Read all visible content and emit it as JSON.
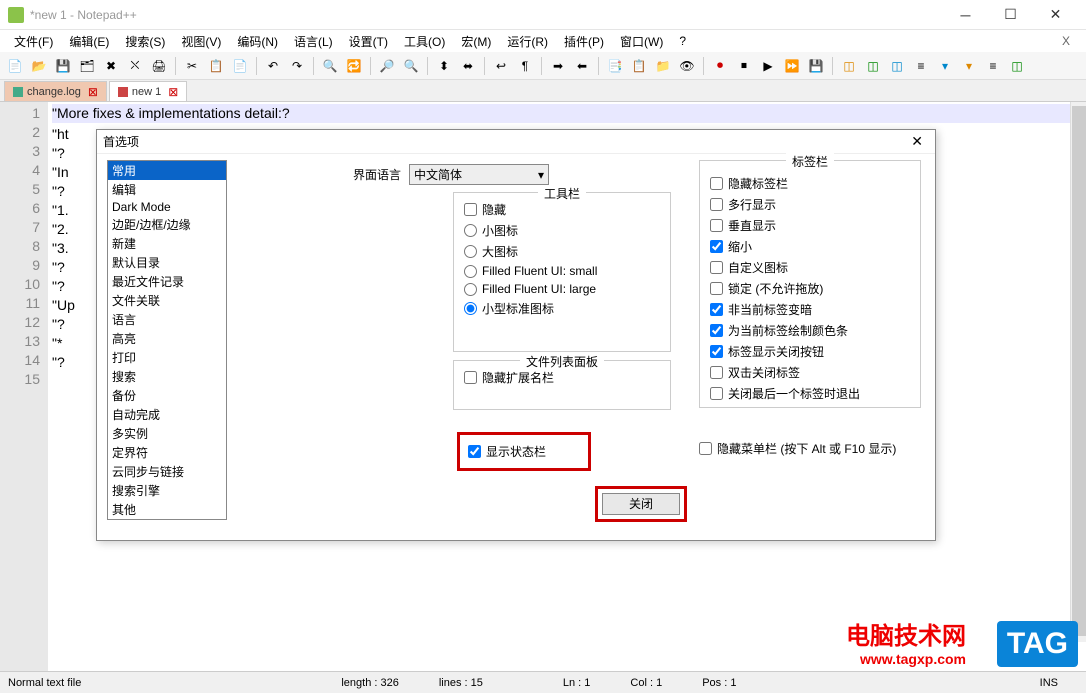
{
  "window": {
    "title": "*new 1 - Notepad++"
  },
  "menu": {
    "items": [
      "文件(F)",
      "编辑(E)",
      "搜索(S)",
      "视图(V)",
      "编码(N)",
      "语言(L)",
      "设置(T)",
      "工具(O)",
      "宏(M)",
      "运行(R)",
      "插件(P)",
      "窗口(W)",
      "?"
    ],
    "x": "X"
  },
  "tabs": [
    {
      "label": "change.log",
      "active": false
    },
    {
      "label": "new 1",
      "active": true
    }
  ],
  "code": {
    "lines": [
      "\"More fixes & implementations detail:?",
      "\"ht",
      "\"?",
      "\"In",
      "\"?",
      "\"1.",
      "\"2.",
      "\"3.",
      "\"?",
      "\"?",
      "\"Up",
      "\"?",
      "\"*",
      "\"?"
    ],
    "line_numbers": [
      "1",
      "2",
      "3",
      "4",
      "5",
      "6",
      "7",
      "8",
      "9",
      "10",
      "11",
      "12",
      "13",
      "14",
      "15"
    ]
  },
  "statusbar": {
    "file_type": "Normal text file",
    "length": "length : 326",
    "lines": "lines : 15",
    "ln": "Ln : 1",
    "col": "Col : 1",
    "pos": "Pos : 1",
    "ins": "INS"
  },
  "dialog": {
    "title": "首选项",
    "categories": [
      "常用",
      "编辑",
      "Dark Mode",
      "边距/边框/边缘",
      "新建",
      "默认目录",
      "最近文件记录",
      "文件关联",
      "语言",
      "高亮",
      "打印",
      "搜索",
      "备份",
      "自动完成",
      "多实例",
      "定界符",
      "云同步与链接",
      "搜索引擎",
      "其他"
    ],
    "ui_lang_label": "界面语言",
    "ui_lang_value": "中文简体",
    "toolbar_legend": "工具栏",
    "toolbar_opts": {
      "hide": "隐藏",
      "small": "小图标",
      "large": "大图标",
      "fluent_small": "Filled Fluent UI: small",
      "fluent_large": "Filled Fluent UI: large",
      "std_small": "小型标准图标"
    },
    "filelist_legend": "文件列表面板",
    "filelist_hide_ext": "隐藏扩展名栏",
    "tabbar_legend": "标签栏",
    "tabbar_opts": {
      "hide": "隐藏标签栏",
      "multiline": "多行显示",
      "vertical": "垂直显示",
      "reduce": "缩小",
      "custom_icon": "自定义图标",
      "lock": "锁定 (不允许拖放)",
      "inactive_dark": "非当前标签变暗",
      "color_bar": "为当前标签绘制颜色条",
      "show_close": "标签显示关闭按钮",
      "dblclick_close": "双击关闭标签",
      "close_last_exit": "关闭最后一个标签时退出"
    },
    "show_statusbar": "显示状态栏",
    "hide_menubar": "隐藏菜单栏 (按下 Alt 或 F10 显示)",
    "close_btn": "关闭"
  },
  "watermark": {
    "title": "电脑技术网",
    "url": "www.tagxp.com",
    "tag": "TAG"
  }
}
